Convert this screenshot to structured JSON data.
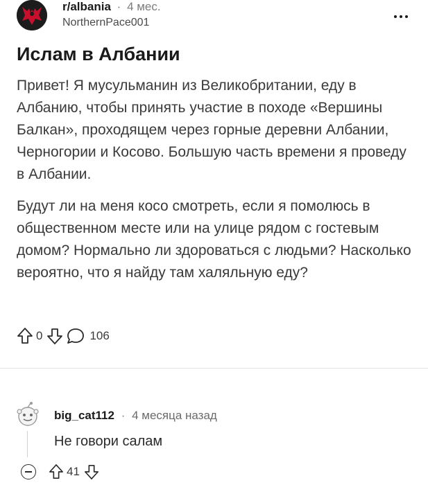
{
  "post": {
    "subreddit": "r/albania",
    "separator": "·",
    "time_ago": "4 мес.",
    "author": "NorthernPace001",
    "more_icon": "ellipsis-icon",
    "title": "Ислам в Албании",
    "paragraphs": [
      "Привет! Я мусульманин из Великобритании, еду в Албанию, чтобы принять участие в походе «Вершины Балкан», проходящем через горные деревни Албании, Черногории и Косово. Большую часть времени я проведу в Албании.",
      "Будут ли на меня косо смотреть, если я помолюсь в общественном месте или на улице рядом с гостевым домом? Нормально ли здороваться с людьми? Насколько вероятно, что я найду там халяльную еду?"
    ],
    "votes": "0",
    "comments_count": "106"
  },
  "comment": {
    "author": "big_cat112",
    "separator": "·",
    "time_ago": "4 месяца назад",
    "text": "Не говори салам",
    "votes": "41"
  },
  "colors": {
    "text": "#1a1a1b",
    "muted": "#7c7c7c",
    "divider": "#e4e4e4",
    "flag_red": "#c8102e"
  }
}
